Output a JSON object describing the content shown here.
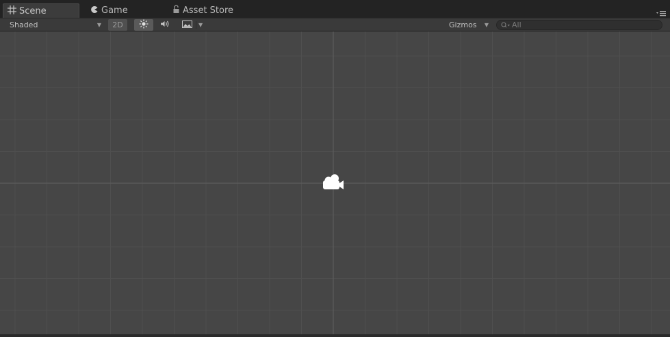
{
  "tabs": [
    {
      "label": "Scene",
      "icon": "grid-icon",
      "active": true
    },
    {
      "label": "Game",
      "icon": "pacman-icon",
      "active": false
    },
    {
      "label": "Asset Store",
      "icon": "lock-icon",
      "active": false
    }
  ],
  "toolbar": {
    "draw_mode": "Shaded",
    "mode_2d": "2D",
    "gizmos": "Gizmos",
    "search_placeholder": "All"
  },
  "colors": {
    "background": "#464646",
    "grid": "#4f4f4f",
    "axis": "#5c5c5c",
    "toolbar": "#3a3a3a"
  }
}
